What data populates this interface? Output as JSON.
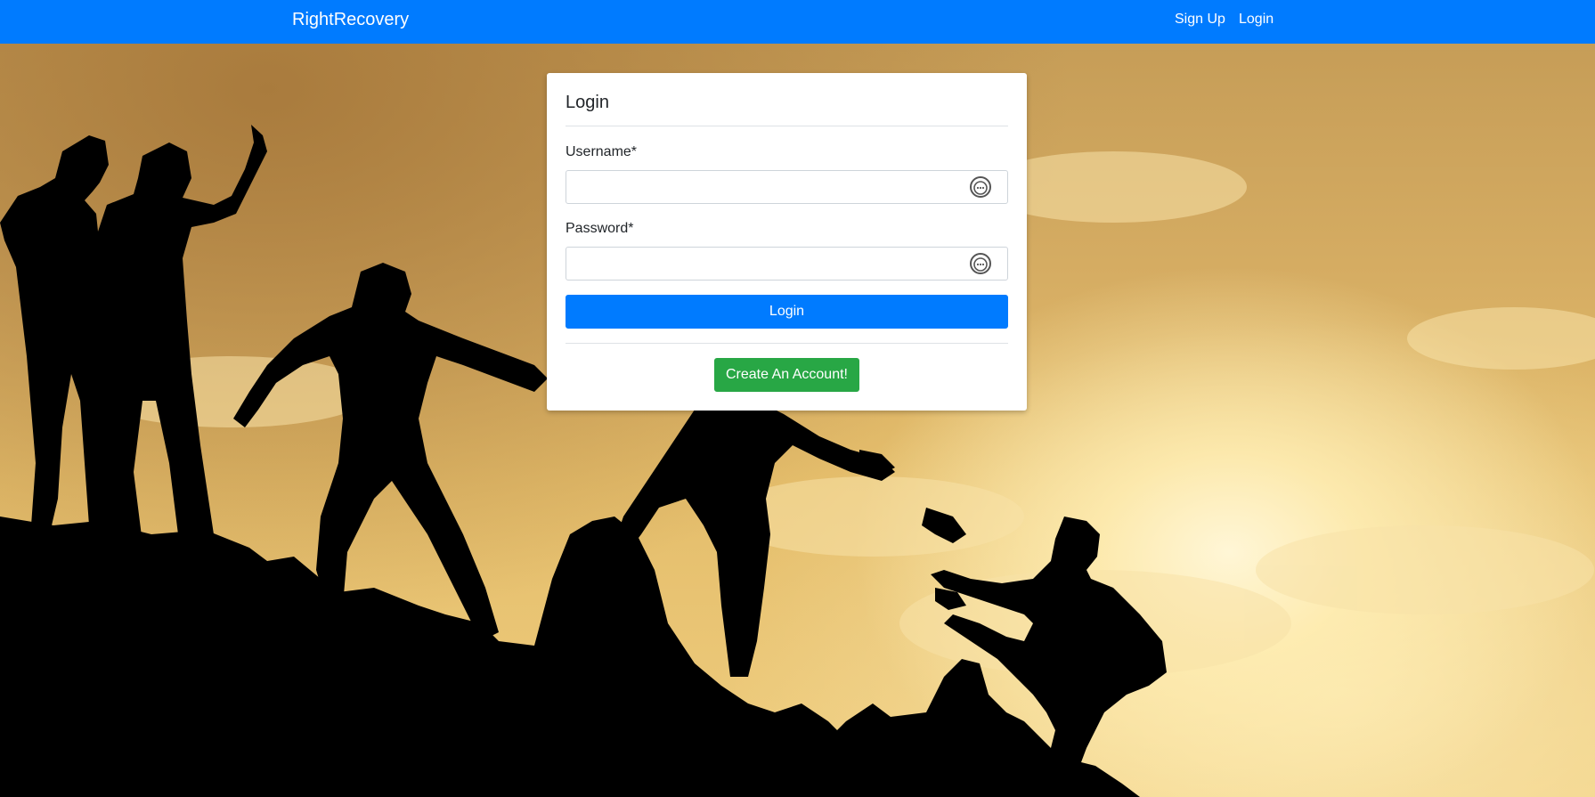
{
  "navbar": {
    "brand": "RightRecovery",
    "links": [
      {
        "label": "Sign Up"
      },
      {
        "label": "Login"
      }
    ]
  },
  "login_card": {
    "title": "Login",
    "username": {
      "label": "Username*",
      "value": "",
      "placeholder": "",
      "icon": "password-manager-icon"
    },
    "password": {
      "label": "Password*",
      "value": "",
      "placeholder": "",
      "icon": "password-manager-icon"
    },
    "login_button": "Login",
    "create_account_button": "Create An Account!"
  },
  "background": {
    "subject": "silhouettes-helping-up-mountain-icon"
  },
  "colors": {
    "navbar": "#007bff",
    "primary_button": "#007bff",
    "success_button": "#28a745",
    "card_background": "#ffffff"
  }
}
